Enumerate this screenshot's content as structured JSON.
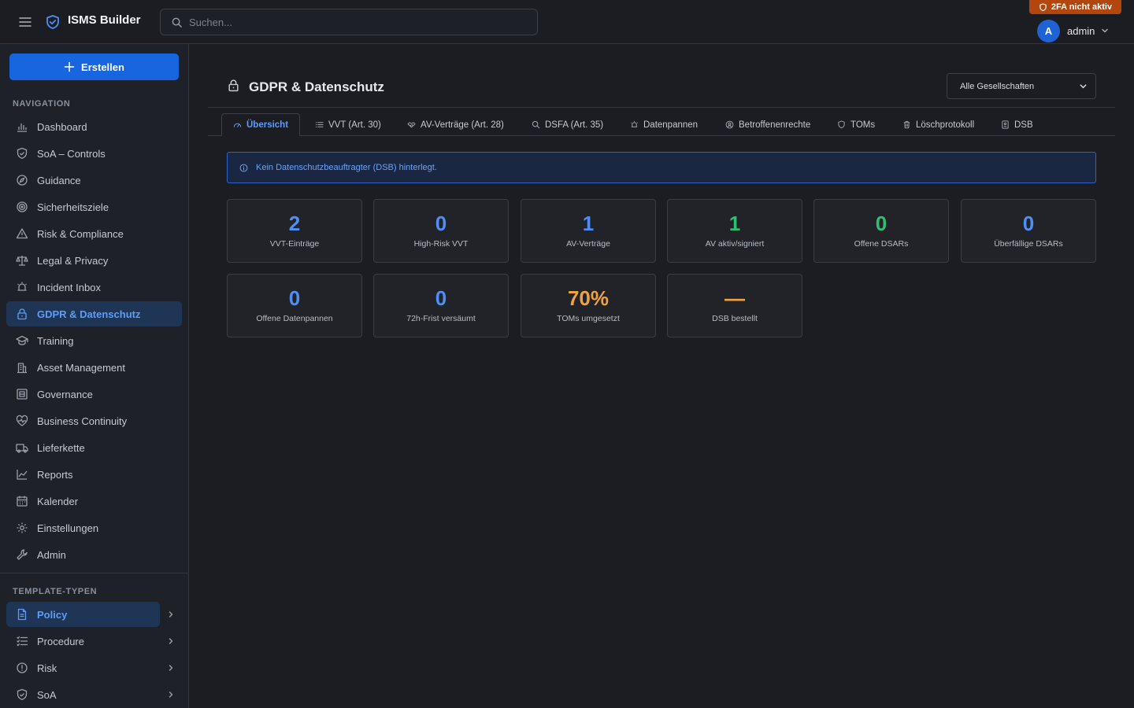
{
  "header": {
    "app_title": "ISMS Builder",
    "search_placeholder": "Suchen...",
    "twofa_badge": "2FA nicht aktiv",
    "user": {
      "initial": "A",
      "name": "admin"
    }
  },
  "sidebar": {
    "create_label": "Erstellen",
    "nav_section": "NAVIGATION",
    "items": [
      {
        "label": "Dashboard",
        "icon": "bar-chart-icon"
      },
      {
        "label": "SoA – Controls",
        "icon": "shield-check-icon"
      },
      {
        "label": "Guidance",
        "icon": "compass-icon"
      },
      {
        "label": "Sicherheitsziele",
        "icon": "target-icon"
      },
      {
        "label": "Risk & Compliance",
        "icon": "warning-triangle-icon"
      },
      {
        "label": "Legal & Privacy",
        "icon": "scale-icon"
      },
      {
        "label": "Incident Inbox",
        "icon": "alarm-icon"
      },
      {
        "label": "GDPR & Datenschutz",
        "icon": "lock-icon"
      },
      {
        "label": "Training",
        "icon": "graduation-cap-icon"
      },
      {
        "label": "Asset Management",
        "icon": "building-icon"
      },
      {
        "label": "Governance",
        "icon": "governance-icon"
      },
      {
        "label": "Business Continuity",
        "icon": "heart-pulse-icon"
      },
      {
        "label": "Lieferkette",
        "icon": "truck-icon"
      },
      {
        "label": "Reports",
        "icon": "line-chart-icon"
      },
      {
        "label": "Kalender",
        "icon": "calendar-icon"
      },
      {
        "label": "Einstellungen",
        "icon": "gear-icon"
      },
      {
        "label": "Admin",
        "icon": "wrench-icon"
      }
    ],
    "active_item": "GDPR & Datenschutz",
    "template_section": "TEMPLATE-TYPEN",
    "templates": [
      {
        "label": "Policy",
        "icon": "document-icon"
      },
      {
        "label": "Procedure",
        "icon": "checklist-icon"
      },
      {
        "label": "Risk",
        "icon": "alert-circle-icon"
      },
      {
        "label": "SoA",
        "icon": "shield-check-icon"
      }
    ],
    "active_template": "Policy"
  },
  "main": {
    "title": "GDPR & Datenschutz",
    "company_select": {
      "value": "Alle Gesellschaften"
    },
    "tabs": [
      {
        "label": "Übersicht",
        "icon": "gauge-icon"
      },
      {
        "label": "VVT (Art. 30)",
        "icon": "list-icon"
      },
      {
        "label": "AV-Verträge (Art. 28)",
        "icon": "handshake-icon"
      },
      {
        "label": "DSFA (Art. 35)",
        "icon": "search-icon"
      },
      {
        "label": "Datenpannen",
        "icon": "alarm-icon"
      },
      {
        "label": "Betroffenenrechte",
        "icon": "user-circle-icon"
      },
      {
        "label": "TOMs",
        "icon": "shield-icon"
      },
      {
        "label": "Löschprotokoll",
        "icon": "trash-icon"
      },
      {
        "label": "DSB",
        "icon": "badge-icon"
      }
    ],
    "active_tab": "Übersicht",
    "alert": "Kein Datenschutzbeauftragter (DSB) hinterlegt.",
    "stats": [
      {
        "value": "2",
        "label": "VVT-Einträge",
        "color": "#4d8ff5"
      },
      {
        "value": "0",
        "label": "High-Risk VVT",
        "color": "#4d8ff5"
      },
      {
        "value": "1",
        "label": "AV-Verträge",
        "color": "#4d8ff5"
      },
      {
        "value": "1",
        "label": "AV aktiv/signiert",
        "color": "#2fbf71"
      },
      {
        "value": "0",
        "label": "Offene DSARs",
        "color": "#2fbf71"
      },
      {
        "value": "0",
        "label": "Überfällige DSARs",
        "color": "#4d8ff5"
      },
      {
        "value": "0",
        "label": "Offene Datenpannen",
        "color": "#4d8ff5"
      },
      {
        "value": "0",
        "label": "72h-Frist versäumt",
        "color": "#4d8ff5"
      },
      {
        "value": "70%",
        "label": "TOMs umgesetzt",
        "color": "#f0a33c"
      },
      {
        "value": "—",
        "label": "DSB bestellt",
        "color": "#f0a33c"
      }
    ]
  }
}
